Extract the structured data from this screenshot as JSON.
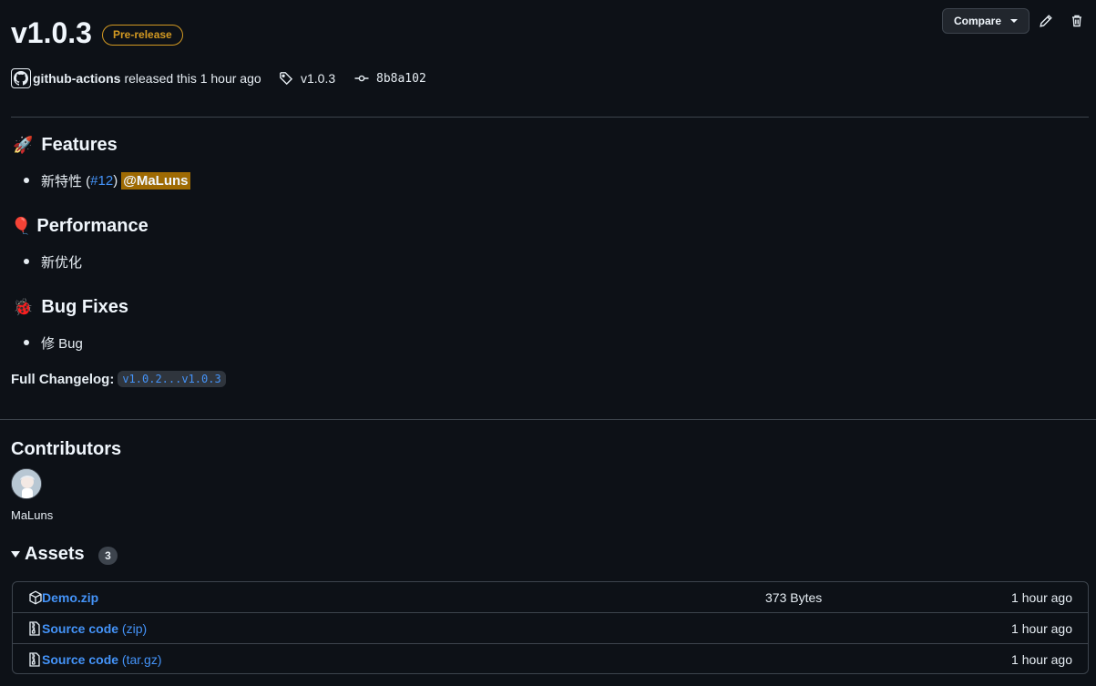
{
  "release": {
    "title": "v1.0.3",
    "badge": "Pre-release",
    "author": "github-actions",
    "released_text": "released this 1 hour ago",
    "tag": "v1.0.3",
    "commit": "8b8a102"
  },
  "toolbar": {
    "compare_label": "Compare",
    "edit_icon": "pencil-icon",
    "delete_icon": "trash-icon"
  },
  "sections": {
    "features": {
      "emoji": "🚀",
      "heading": "Features",
      "item_text": "新特性 (",
      "item_link": "#12",
      "item_close": ")",
      "item_mention": "@MaLuns"
    },
    "performance": {
      "emoji": "🎈",
      "heading": "Performance",
      "item_text": "新优化"
    },
    "bugfixes": {
      "emoji": "🐞",
      "heading": "Bug Fixes",
      "item_text": "修 Bug"
    }
  },
  "changelog": {
    "label": "Full Changelog:",
    "range": "v1.0.2...v1.0.3"
  },
  "contributors": {
    "heading": "Contributors",
    "name": "MaLuns"
  },
  "assets": {
    "heading": "Assets",
    "count": "3",
    "items": [
      {
        "name": "Demo.zip",
        "sub": "",
        "size": "373 Bytes",
        "time": "1 hour ago",
        "icon": "package-icon"
      },
      {
        "name": "Source code",
        "sub": " (zip)",
        "size": "",
        "time": "1 hour ago",
        "icon": "file-zip-icon"
      },
      {
        "name": "Source code",
        "sub": " (tar.gz)",
        "size": "",
        "time": "1 hour ago",
        "icon": "file-zip-icon"
      }
    ]
  },
  "colors": {
    "background": "#0d1117",
    "link": "#4493f8",
    "prerelease": "#d29922",
    "mention_bg": "#9e6a03",
    "border": "#3d444d"
  }
}
